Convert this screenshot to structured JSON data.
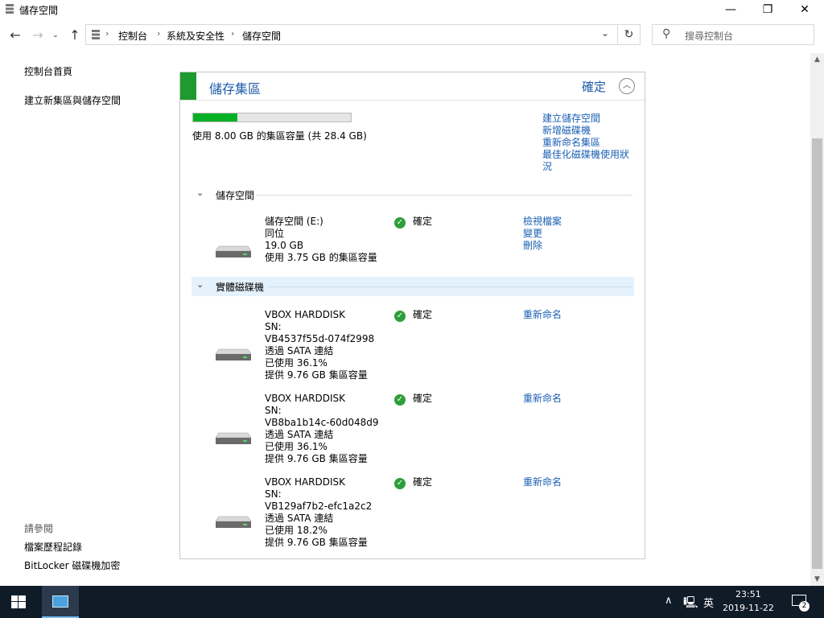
{
  "window": {
    "title": "儲存空間",
    "minimize": "—",
    "maximize": "❐",
    "close": "✕"
  },
  "address": {
    "crumbs": [
      "控制台",
      "系統及安全性",
      "儲存空間"
    ],
    "search_placeholder": "搜尋控制台"
  },
  "left_nav": {
    "items": [
      "控制台首頁",
      "建立新集區與儲存空間"
    ],
    "see_also_label": "請參閱",
    "see_also": [
      "檔案歷程記錄",
      "BitLocker 磁碟機加密"
    ]
  },
  "pool": {
    "title": "儲存集區",
    "status": "確定",
    "usage_text": "使用 8.00 GB 的集區容量 (共 28.4 GB)",
    "usage_fraction": 0.28,
    "actions": [
      "建立儲存空間",
      "新增磁碟機",
      "重新命名集區",
      "最佳化磁碟機使用狀",
      "況"
    ]
  },
  "storage_spaces": {
    "header": "儲存空間",
    "items": [
      {
        "lines": [
          "儲存空間 (E:)",
          "同位",
          "19.0 GB",
          "使用 3.75 GB 的集區容量"
        ],
        "status": "確定",
        "actions": [
          "檢視檔案",
          "變更",
          "刪除"
        ]
      }
    ]
  },
  "physical_drives": {
    "header": "實體磁碟機",
    "items": [
      {
        "lines": [
          "VBOX HARDDISK",
          "SN:",
          "VB4537f55d-074f2998",
          "透過 SATA 連結",
          "已使用 36.1%",
          "提供 9.76 GB 集區容量"
        ],
        "status": "確定",
        "action": "重新命名"
      },
      {
        "lines": [
          "VBOX HARDDISK",
          "SN:",
          "VB8ba1b14c-60d048d9",
          "透過 SATA 連結",
          "已使用 36.1%",
          "提供 9.76 GB 集區容量"
        ],
        "status": "確定",
        "action": "重新命名"
      },
      {
        "lines": [
          "VBOX HARDDISK",
          "SN:",
          "VB129af7b2-efc1a2c2",
          "透過 SATA 連結",
          "已使用 18.2%",
          "提供 9.76 GB 集區容量"
        ],
        "status": "確定",
        "action": "重新命名"
      }
    ]
  },
  "taskbar": {
    "time": "23:51",
    "date": "2019-11-22",
    "ime": "英",
    "notifications": "2"
  },
  "colors": {
    "accent": "#1e5ca8",
    "pool_bar": "#1f9a2f",
    "progress": "#06b025",
    "taskbar": "#101b28"
  }
}
